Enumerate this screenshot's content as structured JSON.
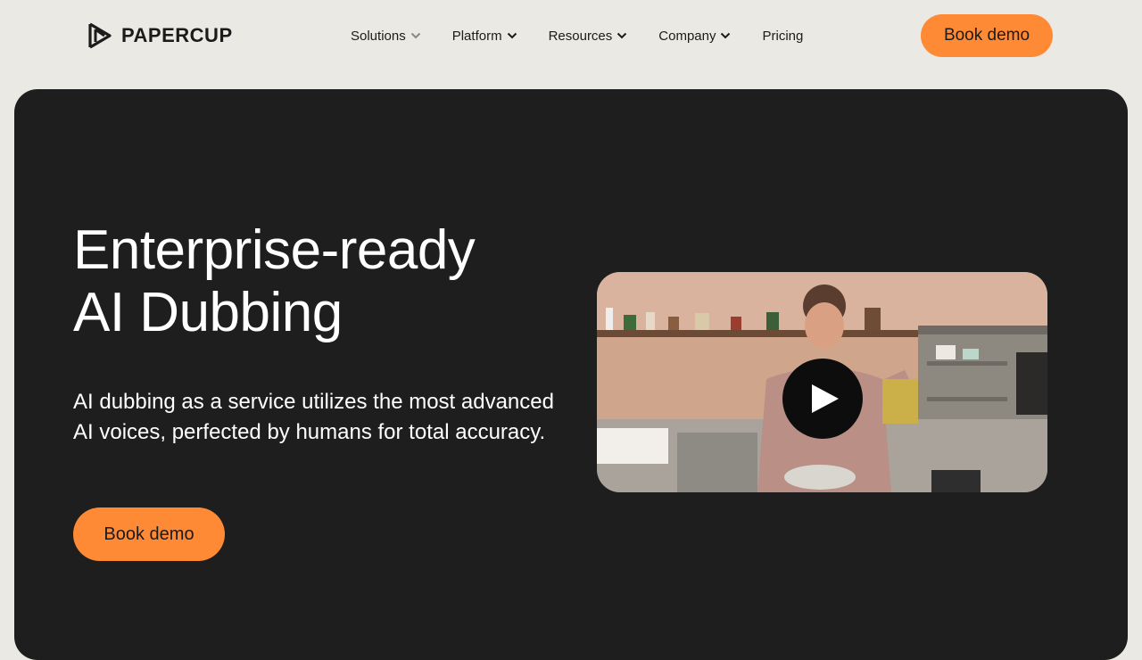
{
  "brand": {
    "name": "PAPERCUP",
    "logo_icon": "papercup-logo-icon"
  },
  "nav": {
    "items": [
      {
        "label": "Solutions",
        "has_dropdown": true
      },
      {
        "label": "Platform",
        "has_dropdown": true
      },
      {
        "label": "Resources",
        "has_dropdown": true
      },
      {
        "label": "Company",
        "has_dropdown": true
      },
      {
        "label": "Pricing",
        "has_dropdown": false
      }
    ],
    "cta": "Book demo"
  },
  "hero": {
    "title_line1": "Enterprise-ready",
    "title_line2": "AI Dubbing",
    "subtitle": "AI dubbing as a service utilizes the most advanced AI voices, perfected by humans for total accuracy.",
    "cta": "Book demo",
    "video": {
      "play_icon": "play-icon"
    }
  },
  "colors": {
    "background": "#ebe9e4",
    "hero_background": "#1e1e1e",
    "accent": "#ff8a35",
    "text_dark": "#1c1b1b",
    "text_light": "#ffffff"
  }
}
